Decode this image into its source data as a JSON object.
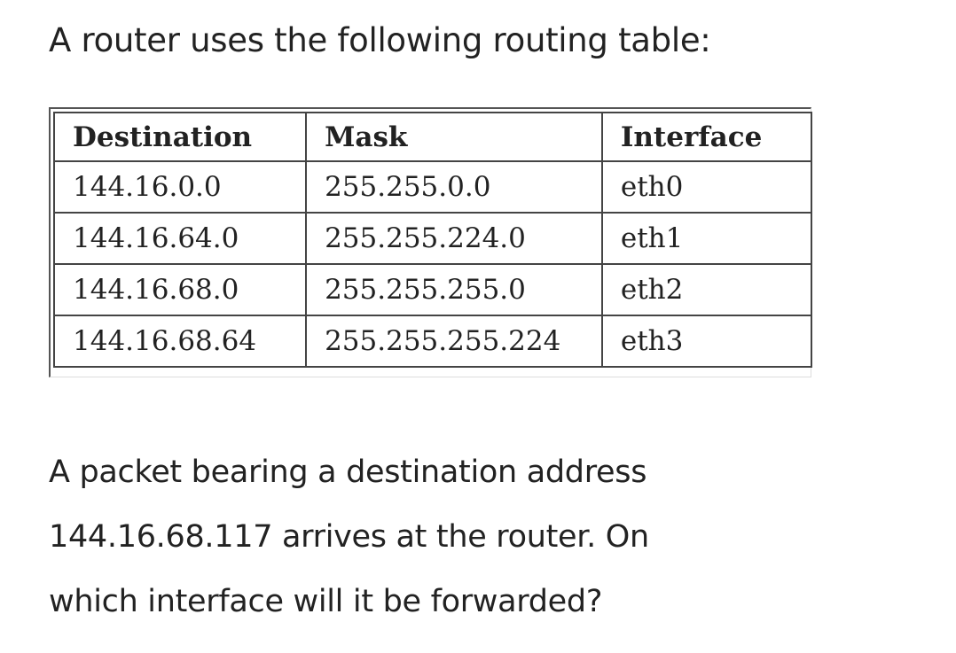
{
  "intro": "A router uses the following routing table:",
  "routing_table": {
    "headers": [
      "Destination",
      "Mask",
      "Interface"
    ],
    "rows": [
      [
        "144.16.0.0",
        "255.255.0.0",
        "eth0"
      ],
      [
        "144.16.64.0",
        "255.255.224.0",
        "eth1"
      ],
      [
        "144.16.68.0",
        "255.255.255.0",
        "eth2"
      ],
      [
        "144.16.68.64",
        "255.255.255.224",
        "eth3"
      ]
    ]
  },
  "question": {
    "lines": [
      "A packet bearing a destination address",
      "144.16.68.117 arrives at the router. On",
      "which interface will it be forwarded?"
    ]
  }
}
